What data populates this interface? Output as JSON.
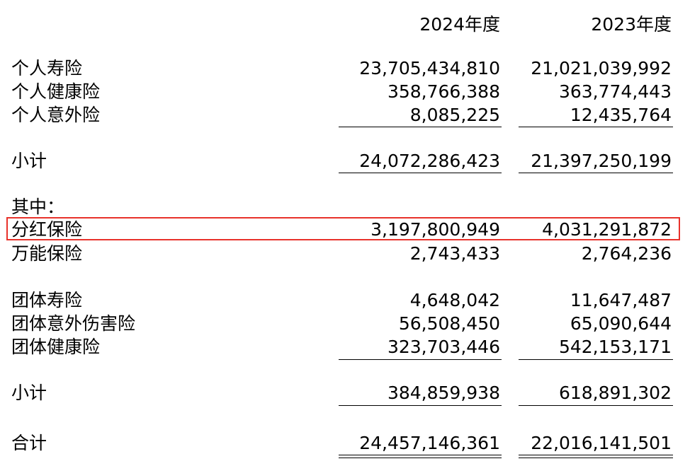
{
  "header": {
    "col1": "2024年度",
    "col2": "2023年度"
  },
  "rows": [
    {
      "label": "个人寿险",
      "v2024": "23,705,434,810",
      "v2023": "21,021,039,992"
    },
    {
      "label": "个人健康险",
      "v2024": "358,766,388",
      "v2023": "363,774,443"
    },
    {
      "label": "个人意外险",
      "v2024": "8,085,225",
      "v2023": "12,435,764"
    },
    {
      "label": "小计",
      "v2024": "24,072,286,423",
      "v2023": "21,397,250,199"
    },
    {
      "label": "其中：",
      "v2024": "",
      "v2023": ""
    },
    {
      "label": "分红保险",
      "v2024": "3,197,800,949",
      "v2023": "4,031,291,872"
    },
    {
      "label": "万能保险",
      "v2024": "2,743,433",
      "v2023": "2,764,236"
    },
    {
      "label": "团体寿险",
      "v2024": "4,648,042",
      "v2023": "11,647,487"
    },
    {
      "label": "团体意外伤害险",
      "v2024": "56,508,450",
      "v2023": "65,090,644"
    },
    {
      "label": "团体健康险",
      "v2024": "323,703,446",
      "v2023": "542,153,171"
    },
    {
      "label": "小计",
      "v2024": "384,859,938",
      "v2023": "618,891,302"
    },
    {
      "label": "合计",
      "v2024": "24,457,146,361",
      "v2023": "22,016,141,501"
    }
  ],
  "highlight_color": "#e8322b"
}
